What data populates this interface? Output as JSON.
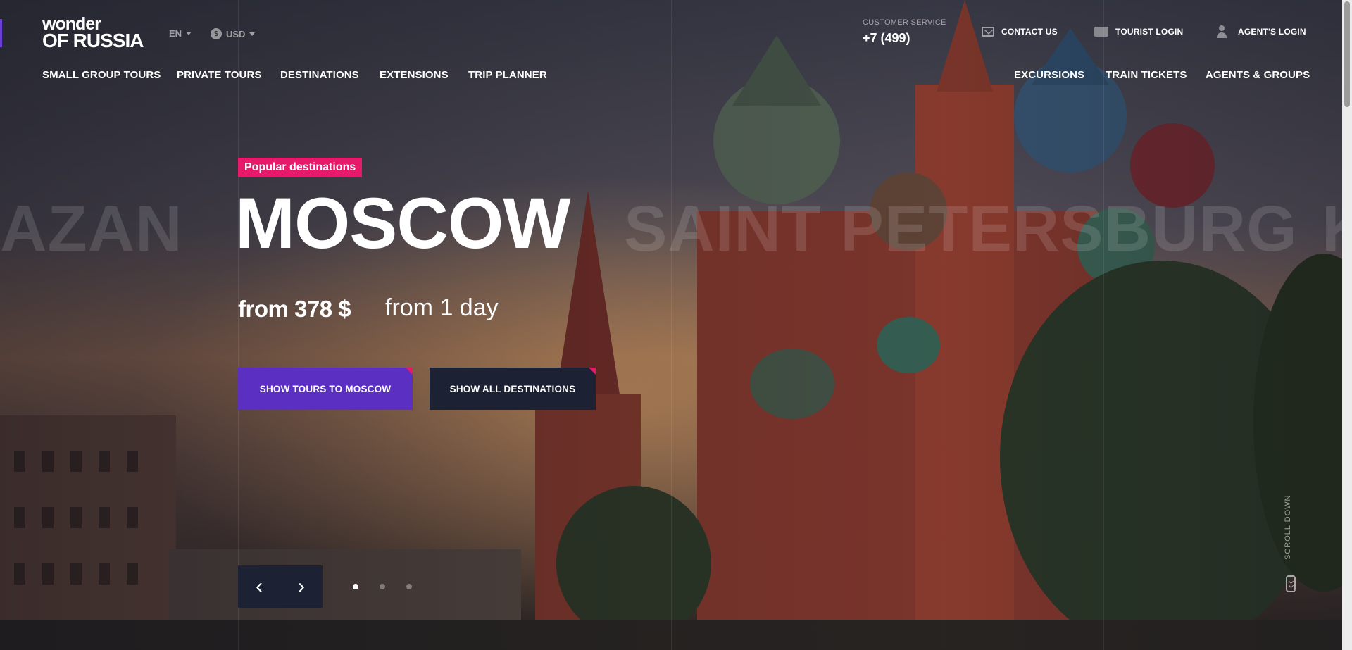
{
  "brand": {
    "logo_line1": "wonder",
    "logo_line2": "OF RUSSIA"
  },
  "header": {
    "language": "EN",
    "currency": "USD",
    "currency_icon": "dollar-coin-icon",
    "customer_service_label": "CUSTOMER SERVICE",
    "phone": "+7 (499)",
    "contact_us": "CONTACT US",
    "tourist_login": "TOURIST LOGIN",
    "agents_login": "AGENT'S LOGIN"
  },
  "nav": {
    "left": [
      "SMALL GROUP TOURS",
      "PRIVATE TOURS",
      "DESTINATIONS",
      "EXTENSIONS",
      "TRIP PLANNER"
    ],
    "right": [
      "EXCURSIONS",
      "TRAIN TICKETS",
      "AGENTS & GROUPS"
    ]
  },
  "hero": {
    "badge": "Popular destinations",
    "prev_city": "AZAN",
    "next_city": "SAINT PETERSBURG",
    "next_next_city": "K",
    "city": "MOSCOW",
    "price": "from 378 $",
    "duration": "from 1 day",
    "primary_button": "SHOW TOURS TO MOSCOW",
    "secondary_button": "SHOW ALL DESTINATIONS",
    "prev_arrow": "‹",
    "next_arrow": "›",
    "slides_total": 3,
    "active_slide": 1,
    "scroll_label": "SCROLL DOWN"
  },
  "colors": {
    "accent_pink": "#e6196b",
    "primary_purple": "#5a2fc2",
    "dark_navy": "#1c2233"
  }
}
